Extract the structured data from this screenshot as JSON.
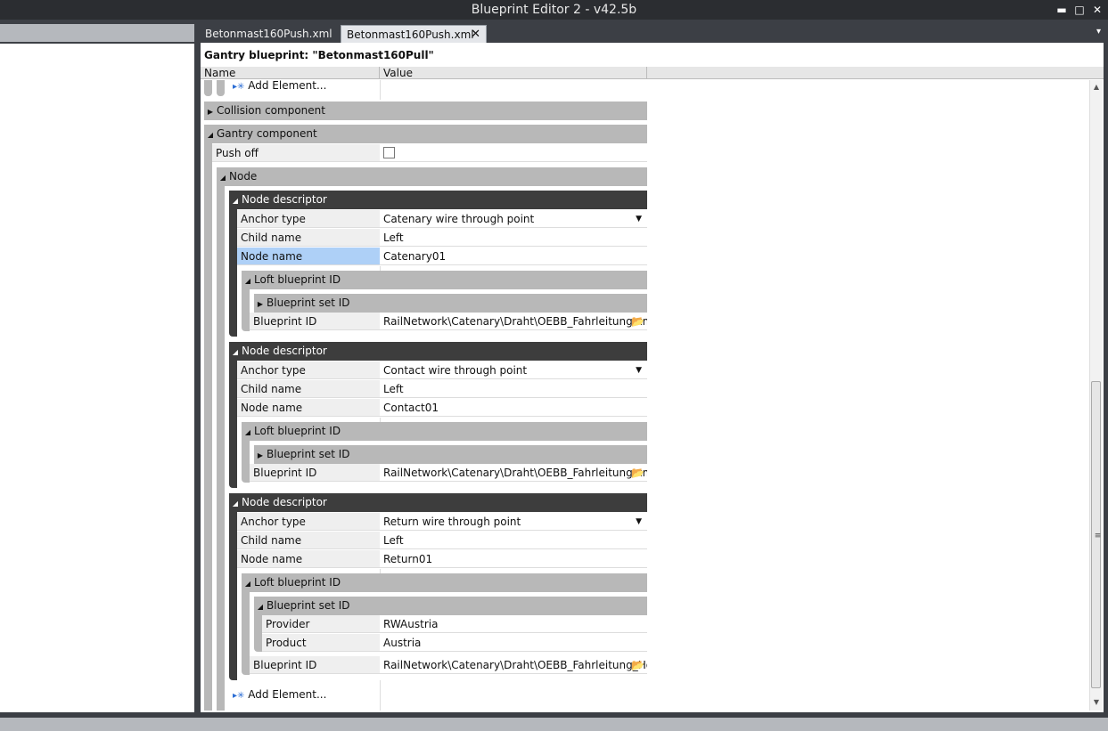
{
  "window": {
    "title": "Blueprint Editor 2 - v42.5b",
    "minimize_glyph": "▬",
    "maximize_glyph": "□",
    "close_glyph": "✕"
  },
  "tabs": [
    {
      "label": "Betonmast160Push.xml"
    },
    {
      "label": "Betonmast160Push.xml",
      "close": "✕"
    }
  ],
  "tab_overflow_glyph": "▾",
  "document": {
    "title": "Gantry blueprint: \"Betonmast160Pull\"",
    "columns": {
      "name": "Name",
      "value": "Value"
    }
  },
  "grid": {
    "add_element_top": "Add Element...",
    "collision_component": "Collision component",
    "gantry_component": "Gantry component",
    "push_off_label": "Push off",
    "node_label": "Node",
    "descriptors": [
      {
        "header": "Node descriptor",
        "anchor_type_label": "Anchor type",
        "anchor_type_value": "Catenary wire through point",
        "child_name_label": "Child name",
        "child_name_value": "Left",
        "node_name_label": "Node name",
        "node_name_value": "Catenary01",
        "loft_label": "Loft blueprint ID",
        "set_label": "Blueprint set ID",
        "blueprint_id_label": "Blueprint ID",
        "blueprint_id_value": "RailNetwork\\Catenary\\Draht\\OEBB_Fahrleitung.xml"
      },
      {
        "header": "Node descriptor",
        "anchor_type_label": "Anchor type",
        "anchor_type_value": "Contact wire through point",
        "child_name_label": "Child name",
        "child_name_value": "Left",
        "node_name_label": "Node name",
        "node_name_value": "Contact01",
        "loft_label": "Loft blueprint ID",
        "set_label": "Blueprint set ID",
        "blueprint_id_label": "Blueprint ID",
        "blueprint_id_value": "RailNetwork\\Catenary\\Draht\\OEBB_Fahrleitung.xml"
      },
      {
        "header": "Node descriptor",
        "anchor_type_label": "Anchor type",
        "anchor_type_value": "Return wire through point",
        "child_name_label": "Child name",
        "child_name_value": "Left",
        "node_name_label": "Node name",
        "node_name_value": "Return01",
        "loft_label": "Loft blueprint ID",
        "set_label": "Blueprint set ID",
        "provider_label": "Provider",
        "provider_value": "RWAustria",
        "product_label": "Product",
        "product_value": "Austria",
        "blueprint_id_label": "Blueprint ID",
        "blueprint_id_value": "RailNetwork\\Catenary\\Draht\\OEBB_Fahrleitung_Ho"
      }
    ],
    "add_element_bottom": "Add Element...",
    "expanded_glyph": "◢",
    "collapsed_glyph": "▶",
    "dropdown_glyph": "▼",
    "folder_glyph": "📂",
    "add_glyph": "▸✳"
  },
  "scrollbar": {
    "up": "▲",
    "down": "▼",
    "grip": "≡"
  }
}
